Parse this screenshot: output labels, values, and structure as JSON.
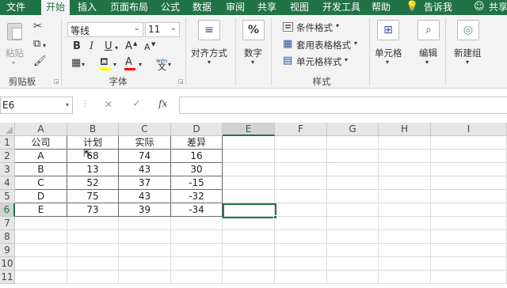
{
  "tabs": {
    "file": "文件",
    "home": "开始",
    "insert": "插入",
    "page_layout": "页面布局",
    "formulas": "公式",
    "data": "数据",
    "review": "审阅",
    "share_tab": "共享",
    "view": "视图",
    "developer": "开发工具",
    "help": "帮助",
    "tell_me": "告诉我",
    "share": "共享"
  },
  "ribbon": {
    "clipboard": {
      "paste": "粘贴",
      "label": "剪贴板"
    },
    "font": {
      "name": "等线",
      "size": "11",
      "bold": "B",
      "italic": "I",
      "underline": "U",
      "grow": "A",
      "shrink": "A",
      "font_color_glyph": "A",
      "wen": "wén",
      "wen_char": "文",
      "label": "字体"
    },
    "alignment": {
      "label": "对齐方式"
    },
    "number": {
      "label": "数字",
      "glyph": "%"
    },
    "styles": {
      "conditional": "条件格式",
      "table": "套用表格格式",
      "cell": "单元格样式",
      "label": "样式"
    },
    "cells": {
      "label": "单元格"
    },
    "editing": {
      "label": "编辑"
    },
    "new_group": {
      "label": "新建组"
    }
  },
  "formula_bar": {
    "name_box": "E6",
    "cancel": "✕",
    "enter": "✓",
    "fx": "fx",
    "formula": ""
  },
  "sheet": {
    "columns": [
      "A",
      "B",
      "C",
      "D",
      "E",
      "F",
      "G",
      "H",
      "I"
    ],
    "selected_column": "E",
    "selected_row": "6",
    "rows": [
      "1",
      "2",
      "3",
      "4",
      "5",
      "6",
      "7",
      "8",
      "9",
      "10",
      "11"
    ],
    "table": [
      [
        "公司",
        "计划",
        "实际",
        "差异"
      ],
      [
        "A",
        "68",
        "74",
        "16"
      ],
      [
        "B",
        "13",
        "43",
        "30"
      ],
      [
        "C",
        "52",
        "37",
        "-15"
      ],
      [
        "D",
        "75",
        "43",
        "-32"
      ],
      [
        "E",
        "73",
        "39",
        "-34"
      ]
    ]
  },
  "colors": {
    "accent": "#217346",
    "selection": "#217346"
  }
}
